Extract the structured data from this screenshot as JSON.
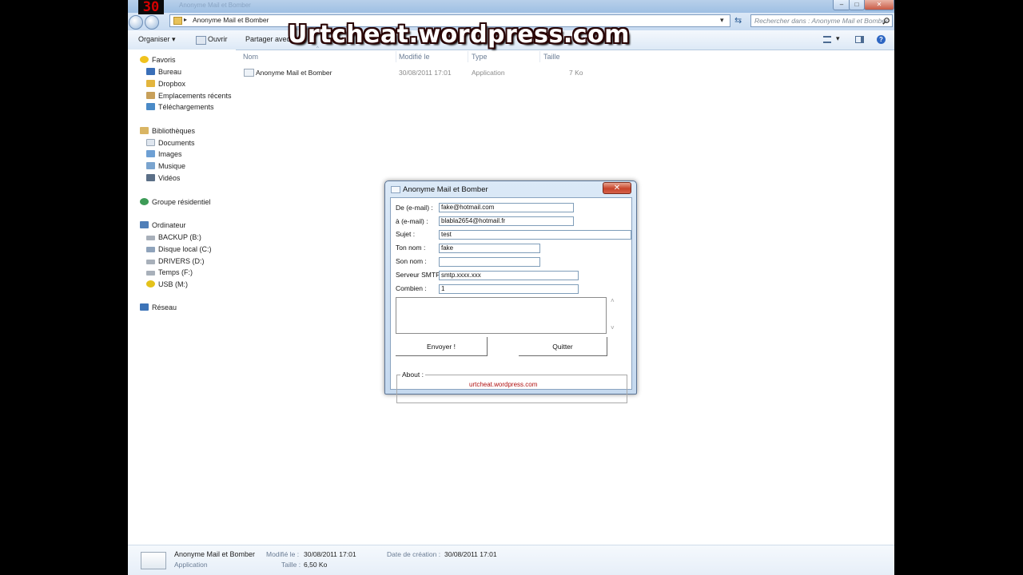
{
  "overlay": {
    "fps": "30",
    "watermark": "Urtcheat.wordpress.com"
  },
  "window": {
    "title_faint": "Anonyme Mail et Bomber",
    "controls": {
      "minimize": "–",
      "maximize": "□",
      "close": "✕"
    }
  },
  "address": {
    "path": "Anonyme Mail et Bomber",
    "separator": "▸",
    "dropdown": "▾",
    "refresh": "⇆",
    "search_placeholder": "Rechercher dans : Anonyme Mail et Bomber",
    "search_icon": "search-icon"
  },
  "toolbar": {
    "organize": "Organiser",
    "open": "Ouvrir",
    "share": "Partager avec",
    "dropdown": "▾"
  },
  "sidebar": {
    "favorites": {
      "label": "Favoris",
      "items": [
        "Bureau",
        "Dropbox",
        "Emplacements récents",
        "Téléchargements"
      ]
    },
    "libraries": {
      "label": "Bibliothèques",
      "items": [
        "Documents",
        "Images",
        "Musique",
        "Vidéos"
      ]
    },
    "homegroup": "Groupe résidentiel",
    "computer": {
      "label": "Ordinateur",
      "items": [
        "BACKUP (B:)",
        "Disque local (C:)",
        "DRIVERS (D:)",
        "Temps (F:)",
        "USB (M:)"
      ]
    },
    "network": "Réseau"
  },
  "columns": {
    "name": "Nom",
    "modified": "Modifié le",
    "type": "Type",
    "size": "Taille"
  },
  "files": [
    {
      "name": "Anonyme Mail et Bomber",
      "modified": "30/08/2011 17:01",
      "type": "Application",
      "size": "7 Ko"
    }
  ],
  "details": {
    "name": "Anonyme Mail et Bomber",
    "type": "Application",
    "modified_label": "Modifié le :",
    "modified": "30/08/2011 17:01",
    "created_label": "Date de création :",
    "created": "30/08/2011 17:01",
    "size_label": "Taille :",
    "size": "6,50 Ko"
  },
  "dialog": {
    "title": "Anonyme Mail et Bomber",
    "close": "✕",
    "fields": {
      "from_label": "De (e-mail) :",
      "from_value": "fake@hotmail.com",
      "to_label": "à (e-mail) :",
      "to_value": "blabla2654@hotmail.fr",
      "subject_label": "Sujet :",
      "subject_value": "test",
      "your_name_label": "Ton nom :",
      "your_name_value": "fake",
      "their_name_label": "Son nom :",
      "their_name_value": "",
      "smtp_label": "Serveur SMTP",
      "smtp_value": "smtp.xxxx.xxx",
      "count_label": "Combien :",
      "count_value": "1"
    },
    "scroll_up": "˄",
    "scroll_down": "˅",
    "send": "Envoyer !",
    "quit": "Quitter",
    "about_label": "About :",
    "about_text": "urtcheat.wordpress.com"
  },
  "colors": {
    "accent": "#9ebfe3",
    "about_text": "#b01010",
    "close_red": "#c7442b"
  }
}
